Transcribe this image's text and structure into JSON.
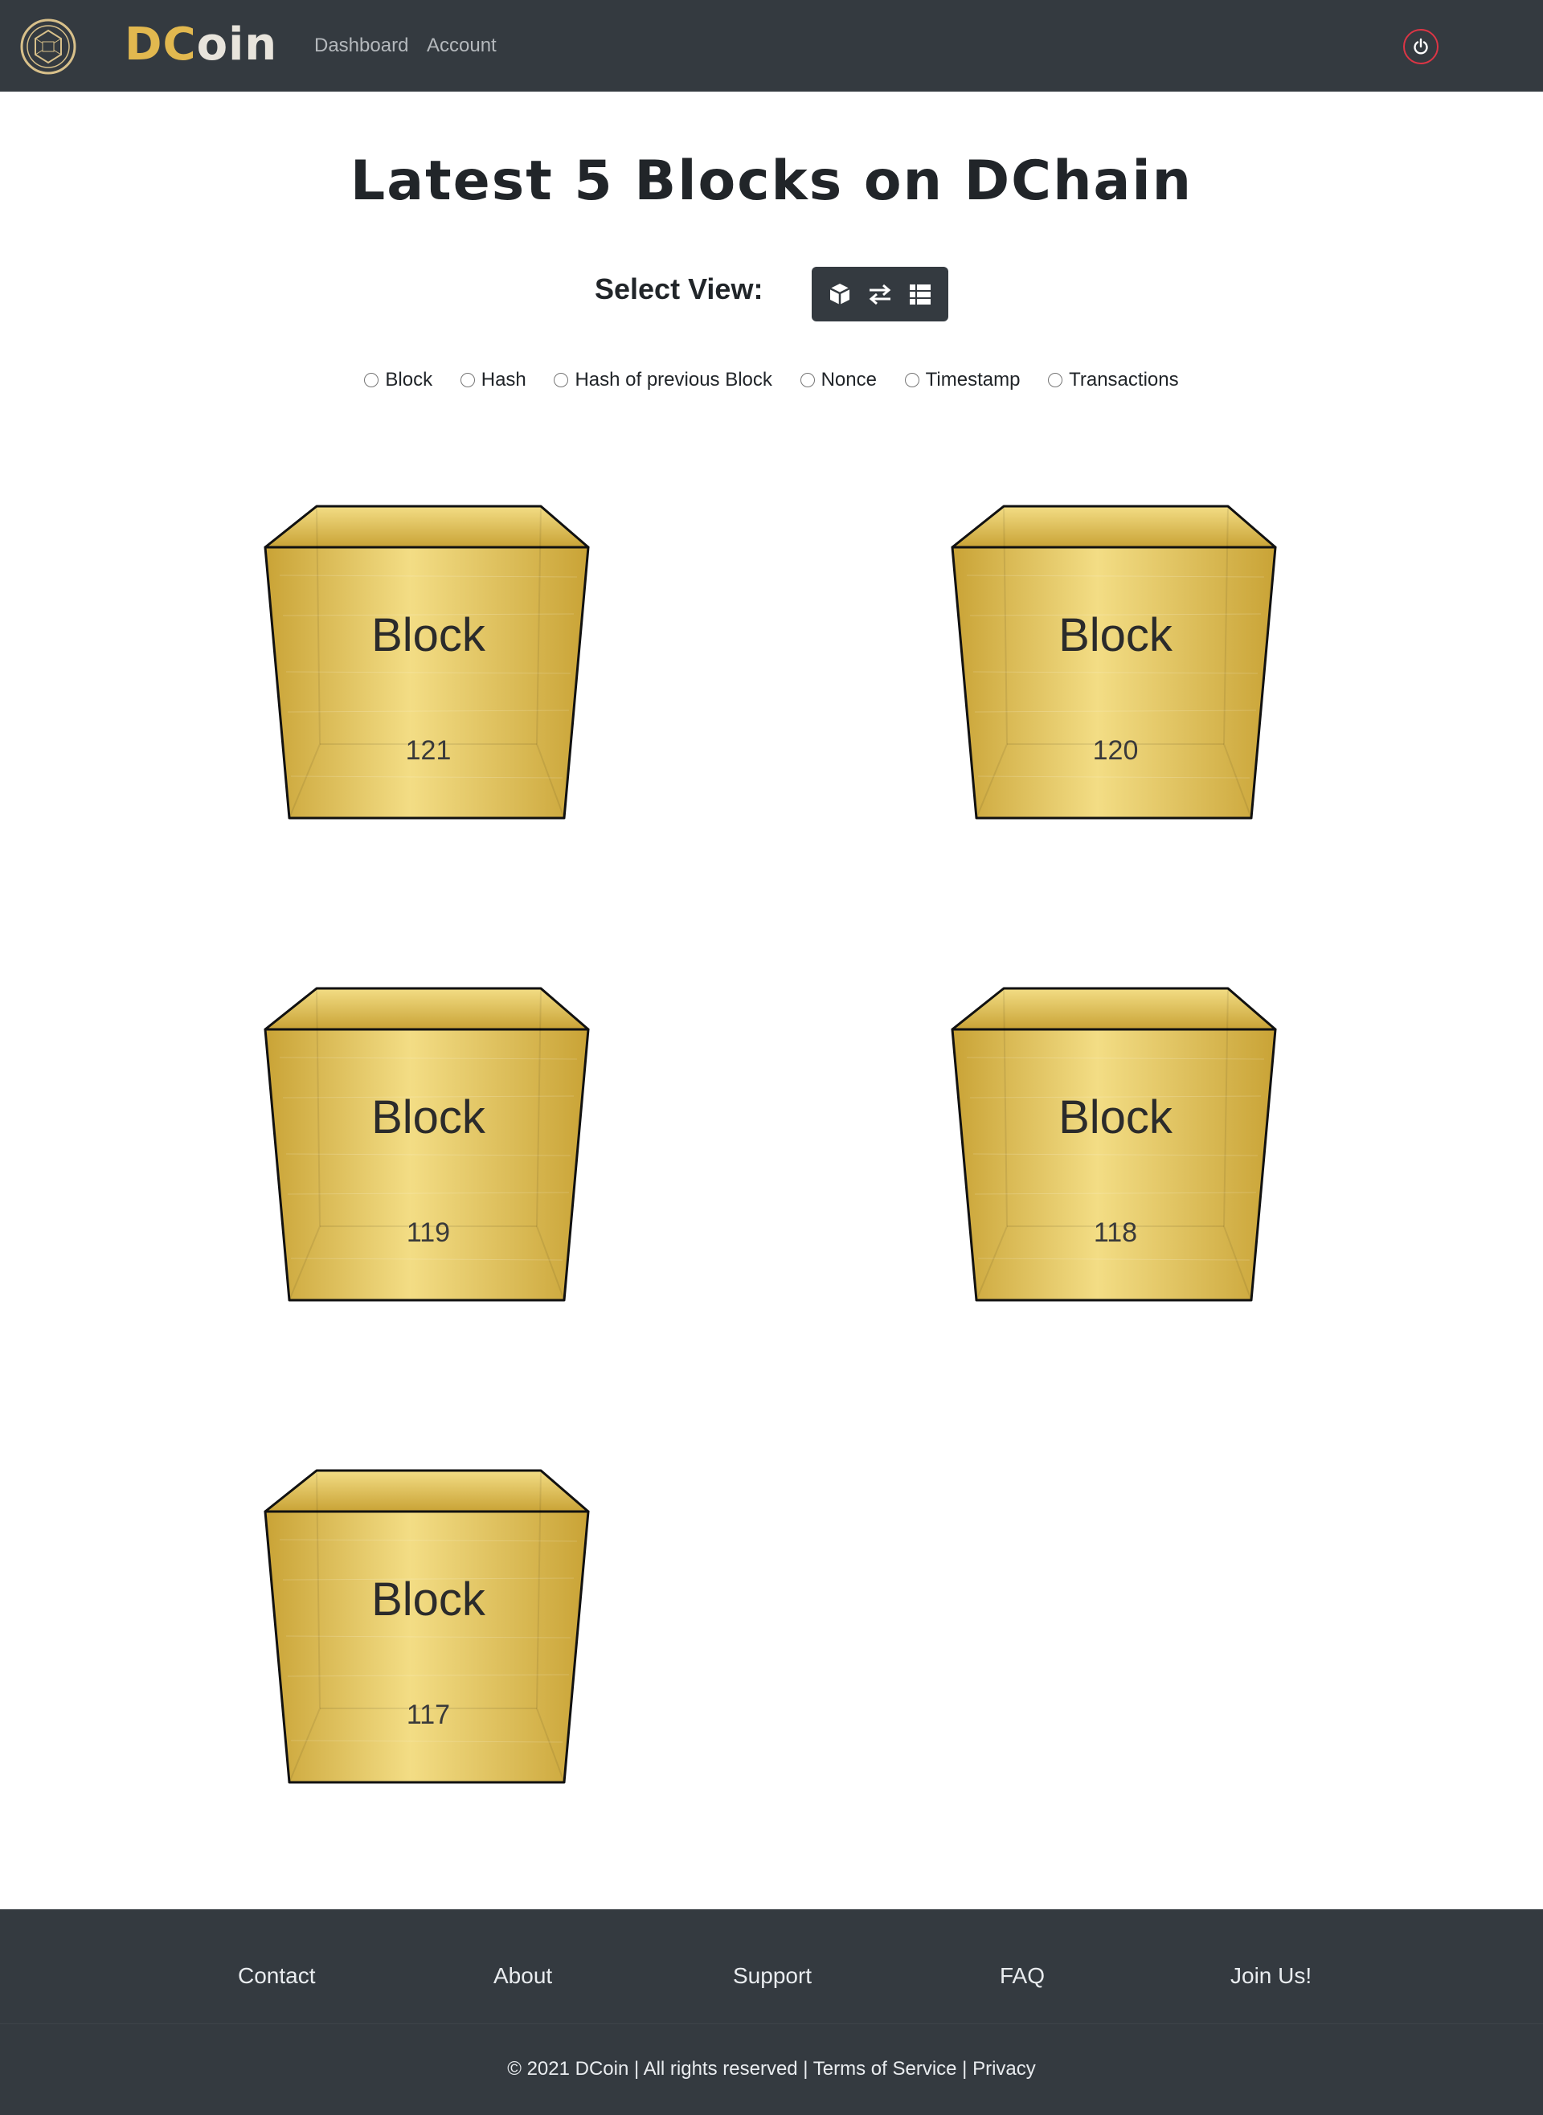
{
  "nav": {
    "brand_part1": "DC",
    "brand_part2": "oin",
    "links": [
      "Dashboard",
      "Account"
    ]
  },
  "page": {
    "title": "Latest 5 Blocks on DChain",
    "select_view_label": "Select View:",
    "view_buttons": [
      "cube-icon",
      "exchange-arrows-icon",
      "list-icon"
    ]
  },
  "filters": [
    "Block",
    "Hash",
    "Hash of previous Block",
    "Nonce",
    "Timestamp",
    "Transactions"
  ],
  "blocks": [
    {
      "label": "Block",
      "number": "121"
    },
    {
      "label": "Block",
      "number": "120"
    },
    {
      "label": "Block",
      "number": "119"
    },
    {
      "label": "Block",
      "number": "118"
    },
    {
      "label": "Block",
      "number": "117"
    }
  ],
  "footer": {
    "links": [
      "Contact",
      "About",
      "Support",
      "FAQ",
      "Join Us!"
    ],
    "copyright": "© 2021 DCoin | All rights reserved |",
    "terms": "Terms of Service",
    "separator": "|",
    "privacy": "Privacy"
  },
  "colors": {
    "navbar": "#343a40",
    "brand_gold": "#e2b84f",
    "gold_light": "#f3dd85",
    "gold_dark": "#c9a336",
    "power_red": "#dc3545"
  }
}
